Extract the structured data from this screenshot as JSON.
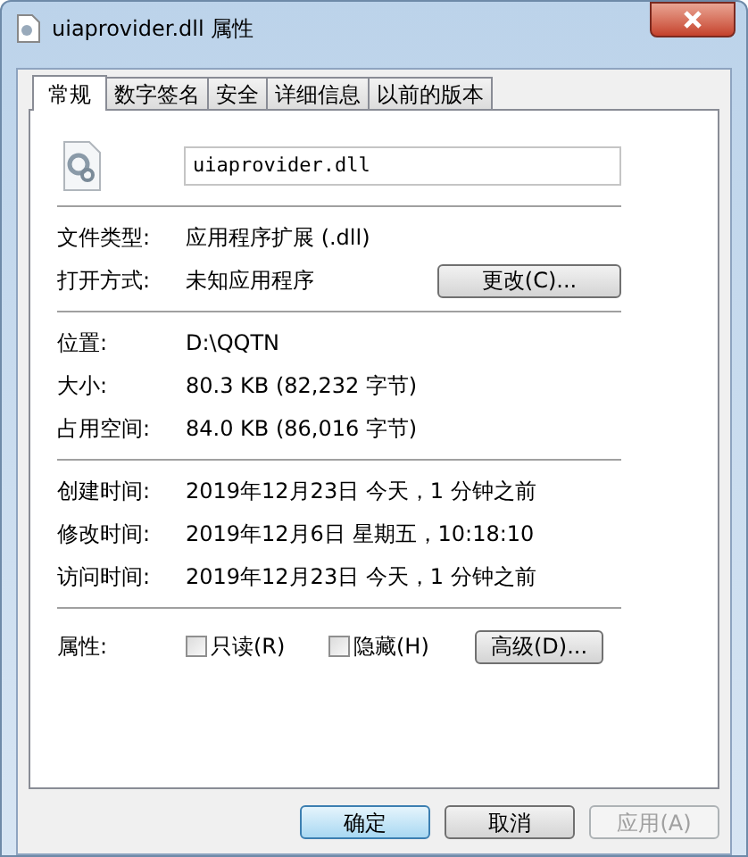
{
  "window": {
    "title": "uiaprovider.dll 属性"
  },
  "tabs": [
    {
      "label": "常规",
      "selected": true
    },
    {
      "label": "数字签名",
      "selected": false
    },
    {
      "label": "安全",
      "selected": false
    },
    {
      "label": "详细信息",
      "selected": false
    },
    {
      "label": "以前的版本",
      "selected": false
    }
  ],
  "file_name": "uiaprovider.dll",
  "sections": [
    {
      "rows": [
        {
          "label": "文件类型:",
          "value": "应用程序扩展 (.dll)"
        },
        {
          "label": "打开方式:",
          "value": "未知应用程序",
          "button": "更改(C)..."
        }
      ]
    },
    {
      "rows": [
        {
          "label": "位置:",
          "value": "D:\\QQTN"
        },
        {
          "label": "大小:",
          "value": "80.3 KB (82,232 字节)"
        },
        {
          "label": "占用空间:",
          "value": "84.0 KB (86,016 字节)"
        }
      ]
    },
    {
      "rows": [
        {
          "label": "创建时间:",
          "value": "2019年12月23日 今天，1 分钟之前"
        },
        {
          "label": "修改时间:",
          "value": "2019年12月6日 星期五，10:18:10"
        },
        {
          "label": "访问时间:",
          "value": "2019年12月23日 今天，1 分钟之前"
        }
      ]
    }
  ],
  "attributes": {
    "label": "属性:",
    "checkboxes": [
      {
        "label": "只读(R)",
        "checked": false
      },
      {
        "label": "隐藏(H)",
        "checked": false
      }
    ],
    "button": "高级(D)..."
  },
  "buttons": [
    {
      "label": "确定",
      "default": true,
      "disabled": false
    },
    {
      "label": "取消",
      "default": false,
      "disabled": false
    },
    {
      "label": "应用(A)",
      "default": false,
      "disabled": true
    }
  ]
}
